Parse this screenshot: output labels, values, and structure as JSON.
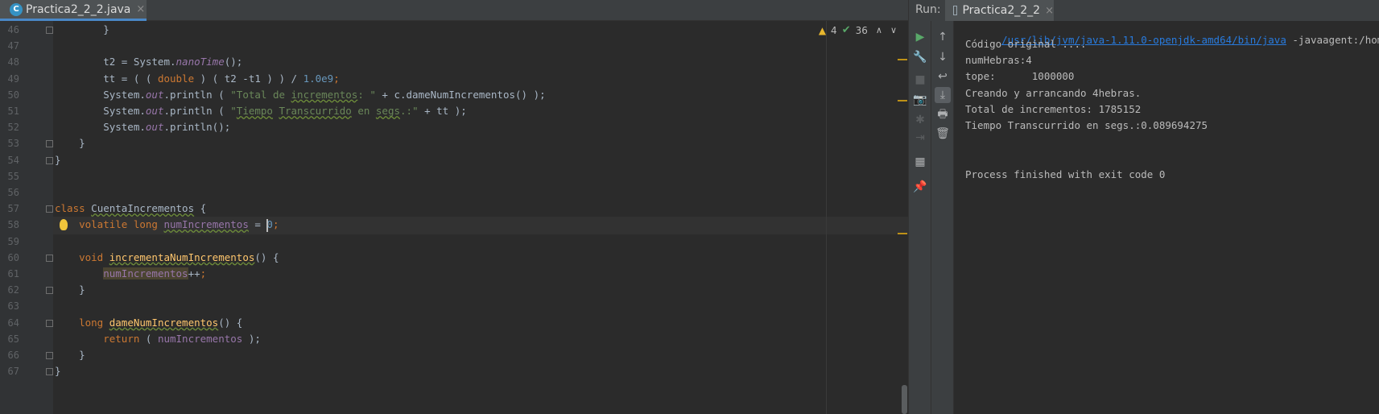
{
  "editor": {
    "tab": {
      "label": "Practica2_2_2.java",
      "icon": "java-class-icon",
      "close": "×"
    },
    "inspection": {
      "warnings": "4",
      "typos": "36"
    },
    "current_line": "58",
    "lines": [
      {
        "n": "46",
        "segs": [
          {
            "t": "        }",
            "c": ""
          }
        ]
      },
      {
        "n": "47",
        "segs": [
          {
            "t": "",
            "c": ""
          }
        ]
      },
      {
        "n": "48",
        "segs": [
          {
            "t": "        t2 = System.",
            "c": ""
          },
          {
            "t": "nanoTime",
            "c": "it"
          },
          {
            "t": "();",
            "c": ""
          }
        ]
      },
      {
        "n": "49",
        "segs": [
          {
            "t": "        tt = ( ( ",
            "c": ""
          },
          {
            "t": "double",
            "c": "kw"
          },
          {
            "t": " ) ( t2 -t1 ) ) / ",
            "c": ""
          },
          {
            "t": "1.0e9",
            "c": "nm"
          },
          {
            "t": ";",
            "c": "kw"
          }
        ]
      },
      {
        "n": "50",
        "segs": [
          {
            "t": "        System.",
            "c": ""
          },
          {
            "t": "out",
            "c": "it"
          },
          {
            "t": ".println ( ",
            "c": ""
          },
          {
            "t": "\"Total de ",
            "c": "st"
          },
          {
            "t": "incrementos",
            "c": "st warnu"
          },
          {
            "t": ": \"",
            "c": "st"
          },
          {
            "t": " + c.dameNumIncrementos() );",
            "c": ""
          }
        ]
      },
      {
        "n": "51",
        "segs": [
          {
            "t": "        System.",
            "c": ""
          },
          {
            "t": "out",
            "c": "it"
          },
          {
            "t": ".println ( ",
            "c": ""
          },
          {
            "t": "\"",
            "c": "st"
          },
          {
            "t": "Tiempo",
            "c": "st warnu"
          },
          {
            "t": " ",
            "c": "st"
          },
          {
            "t": "Transcurrido",
            "c": "st warnu"
          },
          {
            "t": " en ",
            "c": "st"
          },
          {
            "t": "segs",
            "c": "st warnu"
          },
          {
            "t": ".:\"",
            "c": "st"
          },
          {
            "t": " + tt );",
            "c": ""
          }
        ]
      },
      {
        "n": "52",
        "segs": [
          {
            "t": "        System.",
            "c": ""
          },
          {
            "t": "out",
            "c": "it"
          },
          {
            "t": ".println();",
            "c": ""
          }
        ]
      },
      {
        "n": "53",
        "segs": [
          {
            "t": "    }",
            "c": ""
          }
        ]
      },
      {
        "n": "54",
        "segs": [
          {
            "t": "}",
            "c": ""
          }
        ]
      },
      {
        "n": "55",
        "segs": [
          {
            "t": "",
            "c": ""
          }
        ]
      },
      {
        "n": "56",
        "segs": [
          {
            "t": "",
            "c": ""
          }
        ]
      },
      {
        "n": "57",
        "segs": [
          {
            "t": "class",
            "c": "kw"
          },
          {
            "t": " ",
            "c": ""
          },
          {
            "t": "CuentaIncrementos",
            "c": "warnu"
          },
          {
            "t": " {",
            "c": ""
          }
        ]
      },
      {
        "n": "58",
        "segs": [
          {
            "t": "    ",
            "c": ""
          },
          {
            "t": "volatile long",
            "c": "kw"
          },
          {
            "t": " ",
            "c": ""
          },
          {
            "t": "numIncrementos",
            "c": "fld warnu"
          },
          {
            "t": " = ",
            "c": ""
          },
          {
            "t": "0",
            "c": "nm"
          },
          {
            "t": ";",
            "c": "kw"
          }
        ]
      },
      {
        "n": "59",
        "segs": [
          {
            "t": "",
            "c": ""
          }
        ]
      },
      {
        "n": "60",
        "segs": [
          {
            "t": "    ",
            "c": ""
          },
          {
            "t": "void",
            "c": "kw"
          },
          {
            "t": " ",
            "c": ""
          },
          {
            "t": "incrementaNumIncrementos",
            "c": "mth warnu"
          },
          {
            "t": "() {",
            "c": ""
          }
        ]
      },
      {
        "n": "61",
        "segs": [
          {
            "t": "        ",
            "c": ""
          },
          {
            "t": "numIncrementos",
            "c": "hl"
          },
          {
            "t": "++",
            "c": ""
          },
          {
            "t": ";",
            "c": "kw"
          }
        ]
      },
      {
        "n": "62",
        "segs": [
          {
            "t": "    }",
            "c": ""
          }
        ]
      },
      {
        "n": "63",
        "segs": [
          {
            "t": "",
            "c": ""
          }
        ]
      },
      {
        "n": "64",
        "segs": [
          {
            "t": "    ",
            "c": ""
          },
          {
            "t": "long",
            "c": "kw"
          },
          {
            "t": " ",
            "c": ""
          },
          {
            "t": "dameNumIncrementos",
            "c": "mth warnu"
          },
          {
            "t": "() {",
            "c": ""
          }
        ]
      },
      {
        "n": "65",
        "segs": [
          {
            "t": "        ",
            "c": ""
          },
          {
            "t": "return",
            "c": "kw"
          },
          {
            "t": " ( ",
            "c": ""
          },
          {
            "t": "numIncrementos",
            "c": "fld"
          },
          {
            "t": " );",
            "c": ""
          }
        ]
      },
      {
        "n": "66",
        "segs": [
          {
            "t": "    }",
            "c": ""
          }
        ]
      },
      {
        "n": "67",
        "segs": [
          {
            "t": "}",
            "c": ""
          }
        ]
      }
    ]
  },
  "run": {
    "label": "Run:",
    "tab": {
      "label": "Practica2_2_2",
      "icon": "run-config-icon",
      "close": "×"
    },
    "command": {
      "link": "/usr/lib/jvm/java-1.11.0-openjdk-amd64/bin/java",
      "rest": " -javaagent:/home"
    },
    "output": [
      "Código original ....",
      "numHebras:4",
      "tope:      1000000",
      "Creando y arrancando 4hebras.",
      "Total de incrementos: 1785152",
      "Tiempo Transcurrido en segs.:0.089694275",
      "",
      "",
      "Process finished with exit code 0"
    ],
    "toolbar_left": [
      {
        "name": "rerun-icon",
        "glyph": "▶",
        "style": "green"
      },
      {
        "name": "wrench-icon",
        "glyph": "🔧",
        "style": ""
      },
      {
        "name": "stop-icon",
        "glyph": "■",
        "style": "disabled"
      },
      {
        "name": "camera-icon",
        "glyph": "📷",
        "style": "disabled"
      },
      {
        "name": "bug-icon",
        "glyph": "✱",
        "style": "disabled"
      },
      {
        "name": "exit-icon",
        "glyph": "⇥",
        "style": "disabled"
      },
      {
        "name": "layout-icon",
        "glyph": "▦",
        "style": ""
      },
      {
        "name": "pin-icon",
        "glyph": "📌",
        "style": ""
      }
    ],
    "toolbar_right": [
      {
        "name": "arrow-up-icon",
        "glyph": "↑",
        "style": ""
      },
      {
        "name": "arrow-down-icon",
        "glyph": "↓",
        "style": ""
      },
      {
        "name": "soft-wrap-icon",
        "glyph": "↩",
        "style": ""
      },
      {
        "name": "scroll-to-end-icon",
        "glyph": "⤓",
        "style": "active"
      },
      {
        "name": "print-icon",
        "glyph": "🖶",
        "style": ""
      },
      {
        "name": "trash-icon",
        "glyph": "🗑",
        "style": ""
      }
    ]
  }
}
